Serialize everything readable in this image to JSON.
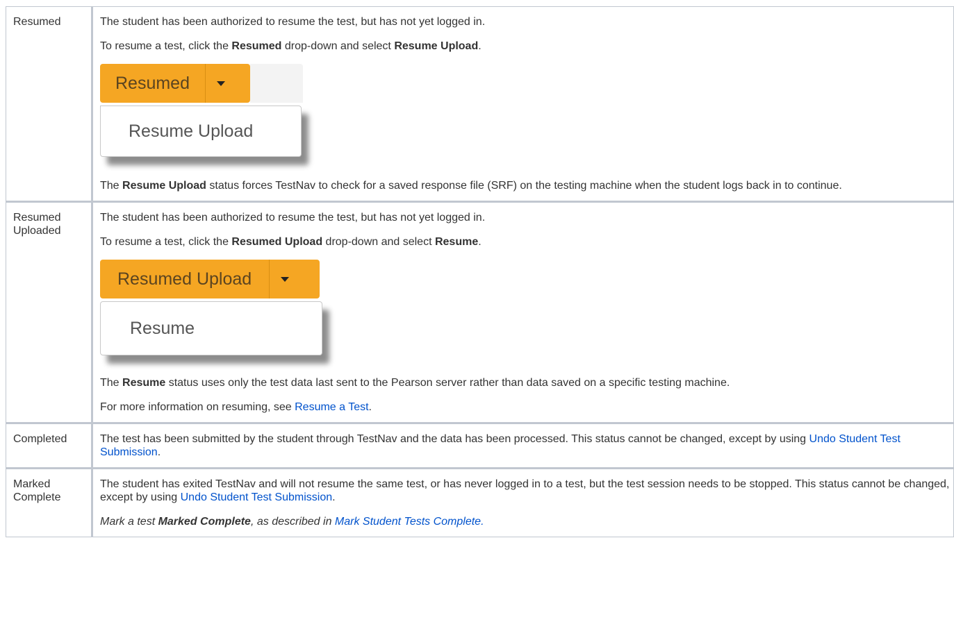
{
  "rows": [
    {
      "status": "Resumed",
      "p1": "The student has been authorized to resume the test, but has not yet logged in.",
      "p2": {
        "pre": "To resume a test, click the ",
        "b1": "Resumed",
        "mid": " drop-down and select ",
        "b2": "Resume Upload",
        "post": "."
      },
      "dropdown": {
        "button_label": "Resumed",
        "menu_item": "Resume Upload"
      },
      "p3": {
        "pre": "The ",
        "b1": "Resume Upload",
        "post": " status forces TestNav to check for a saved response file (SRF) on the testing machine when the student logs back in to continue."
      }
    },
    {
      "status": "Resumed Uploaded",
      "p1": "The student has been authorized to resume the test, but has not yet logged in.",
      "p2": {
        "pre": "To resume a test, click the ",
        "b1": "Resumed Upload",
        "mid": " drop-down and select ",
        "b2": "Resume",
        "post": "."
      },
      "dropdown": {
        "button_label": "Resumed Upload",
        "menu_item": "Resume"
      },
      "p3": {
        "pre": "The ",
        "b1": "Resume",
        "post": " status uses only the test data last sent to the Pearson server rather than data saved on a specific testing machine."
      },
      "p4": {
        "pre": "For more information on resuming, see ",
        "link": "Resume a Test",
        "post": "."
      }
    },
    {
      "status": "Completed",
      "p1": {
        "pre": "The test has been submitted by the student through TestNav and the data has been processed. This status cannot be changed, except by using ",
        "link": "Undo Student Test Submission",
        "post": "."
      }
    },
    {
      "status": "Marked Complete",
      "p1": {
        "pre": "The student has exited TestNav and will not resume the same test, or has never logged in to a test, but the test session needs to be stopped. This status cannot be changed, except by using ",
        "link": "Undo Student Test Submission",
        "post": "."
      },
      "p2": {
        "pre": "Mark a test ",
        "b1": "Marked Complete",
        "mid": ", as described in ",
        "link": "Mark Student Tests Complete.",
        "post": ""
      }
    }
  ],
  "colors": {
    "accent_orange": "#f5a623",
    "link_blue": "#0052cc",
    "border": "#c1c7d0"
  }
}
